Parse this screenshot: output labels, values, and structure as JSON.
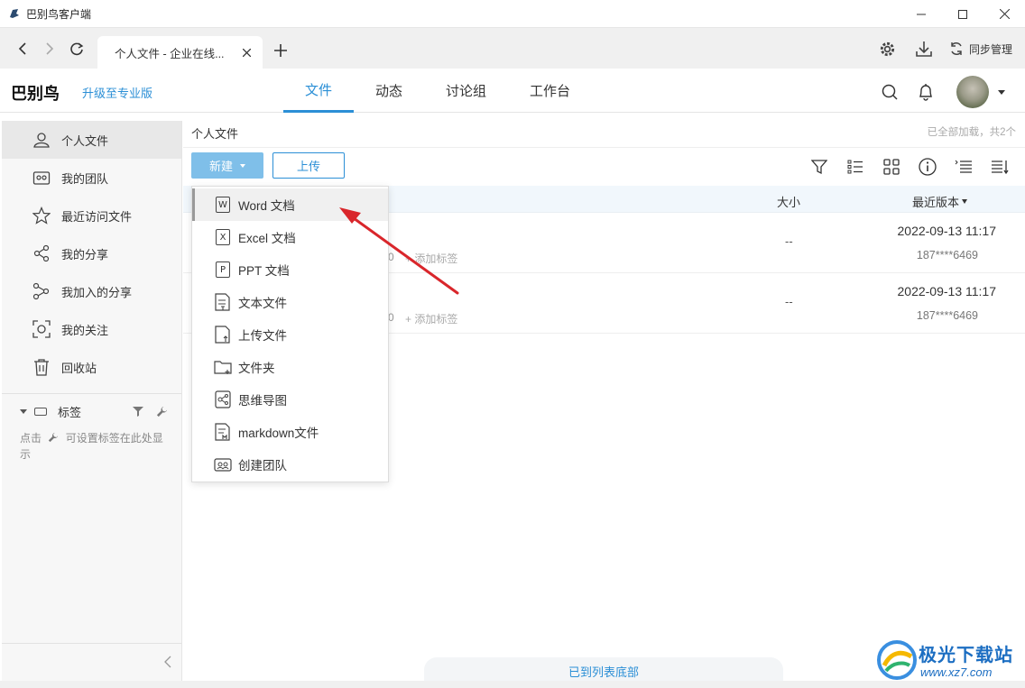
{
  "window": {
    "title": "巴别鸟客户端"
  },
  "browser": {
    "tab_title": "个人文件 - 企业在线...",
    "sync_label": "同步管理"
  },
  "header": {
    "brand": "巴别鸟",
    "upgrade": "升级至专业版",
    "nav": [
      "文件",
      "动态",
      "讨论组",
      "工作台"
    ]
  },
  "sidebar": {
    "items": [
      "个人文件",
      "我的团队",
      "最近访问文件",
      "我的分享",
      "我加入的分享",
      "我的关注",
      "回收站"
    ],
    "tag_title": "标签",
    "tag_hint_prefix": "点击",
    "tag_hint_suffix": "可设置标签在此处显示"
  },
  "content": {
    "breadcrumb": "个人文件",
    "load_status": "已全部加载，共2个",
    "new_button": "新建",
    "upload_button": "上传",
    "col_size": "大小",
    "col_version": "最近版本",
    "rows": [
      {
        "count": "0",
        "add_tag": "添加标签",
        "size": "--",
        "date": "2022-09-13 11:17",
        "user": "187****6469"
      },
      {
        "count": "0",
        "add_tag": "添加标签",
        "size": "--",
        "date": "2022-09-13 11:17",
        "user": "187****6469"
      }
    ],
    "list_end": "已到列表底部"
  },
  "menu": {
    "items": [
      {
        "label": "Word 文档",
        "icon": "W"
      },
      {
        "label": "Excel 文档",
        "icon": "X"
      },
      {
        "label": "PPT 文档",
        "icon": "P"
      },
      {
        "label": "文本文件",
        "icon": "text-file-icon"
      },
      {
        "label": "上传文件",
        "icon": "upload-file-icon"
      },
      {
        "label": "文件夹",
        "icon": "folder-icon"
      },
      {
        "label": "思维导图",
        "icon": "mindmap-icon"
      },
      {
        "label": "markdown文件",
        "icon": "markdown-icon"
      },
      {
        "label": "创建团队",
        "icon": "team-icon"
      }
    ]
  },
  "watermark": {
    "name": "极光下载站",
    "url": "www.xz7.com"
  },
  "colors": {
    "accent": "#2b8fd6",
    "new_button": "#7fbfe9",
    "arrow": "#d9262b"
  }
}
